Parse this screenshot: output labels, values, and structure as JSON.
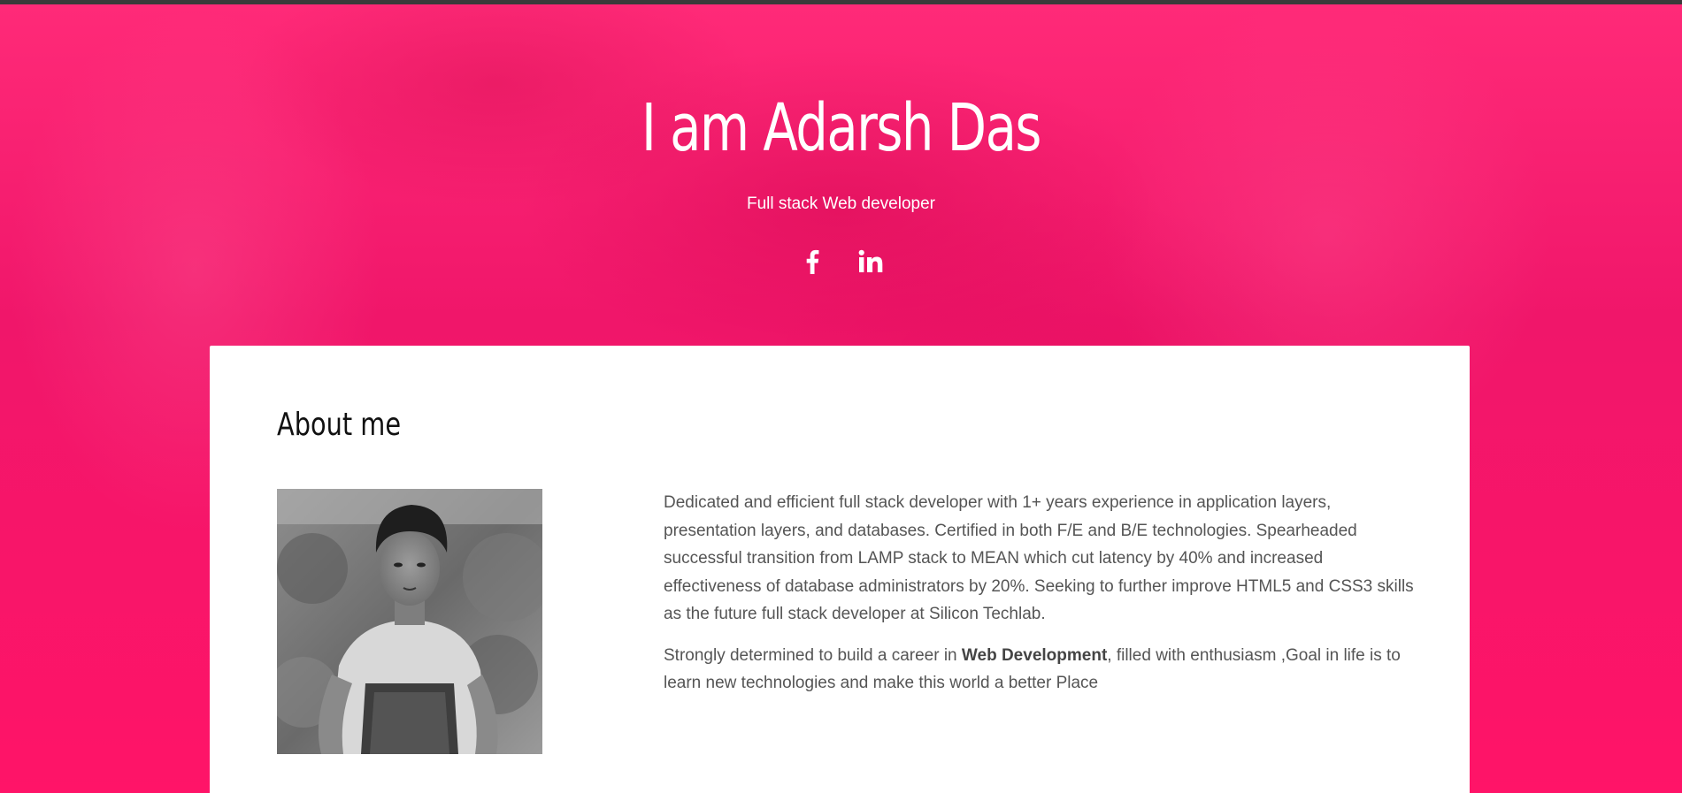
{
  "hero": {
    "title": "I am Adarsh Das",
    "subtitle": "Full stack Web developer",
    "social": [
      {
        "icon": "facebook-icon",
        "label": "f"
      },
      {
        "icon": "linkedin-icon",
        "label": "in"
      }
    ]
  },
  "about": {
    "heading": "About me",
    "paragraph1": "Dedicated and efficient full stack developer with 1+ years experience in application layers, presentation layers, and databases. Certified in both F/E and B/E technologies. Spearheaded successful transition from LAMP stack to MEAN which cut latency by 40% and increased effectiveness of database administrators by 20%. Seeking to further improve HTML5 and CSS3 skills as the future full stack developer at Silicon Techlab.",
    "paragraph2_before": "Strongly determined to build a career in ",
    "paragraph2_bold": "Web Development",
    "paragraph2_after": ", filled with enthusiasm ,Goal in life is to learn new technologies and make this world a better Place"
  },
  "colors": {
    "hero_background": "#ff1a6c",
    "card_background": "#ffffff",
    "body_text": "#555555",
    "heading_text": "#111111"
  }
}
